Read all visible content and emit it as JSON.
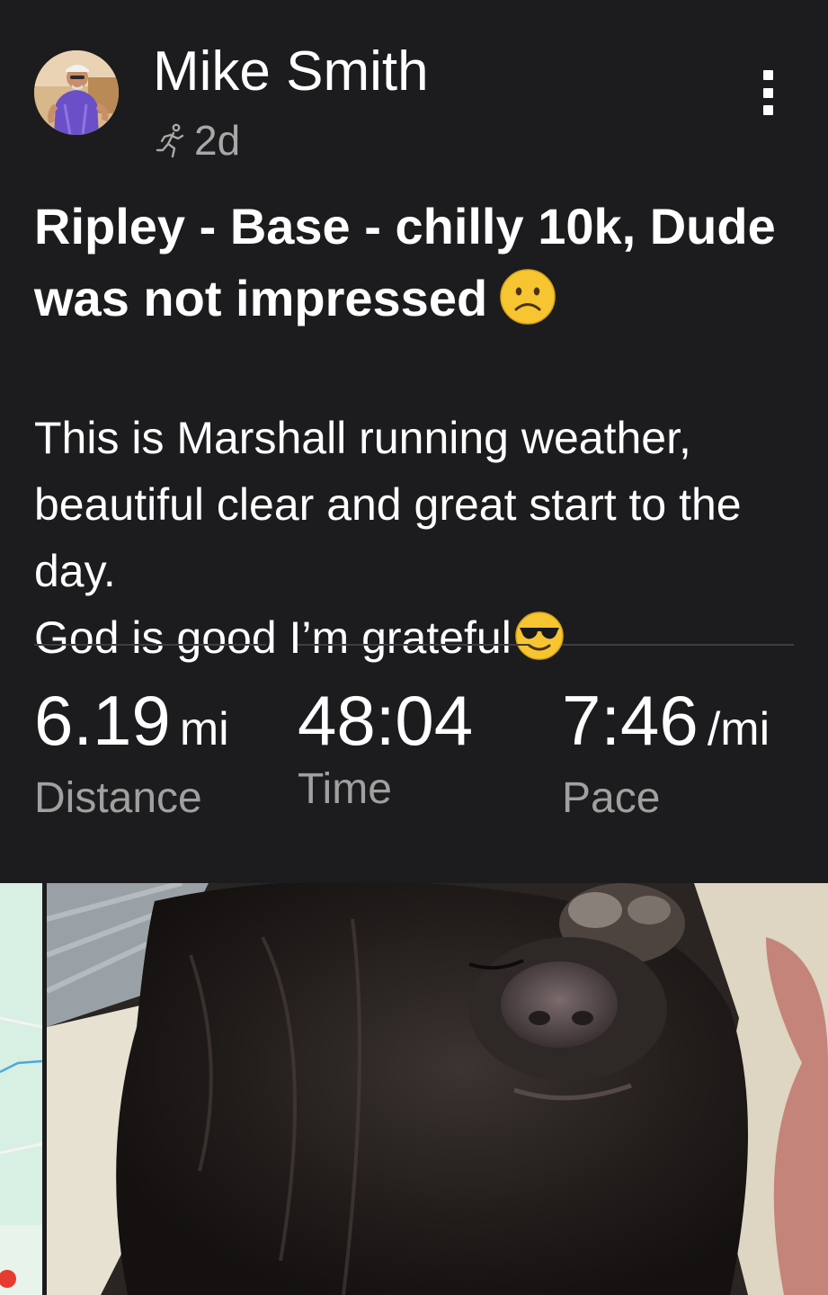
{
  "post": {
    "athlete_name": "Mike Smith",
    "activity_icon": "running-icon",
    "time_ago": "2d",
    "title": "Ripley - Base - chilly 10k, Dude was not impressed",
    "title_emoji": "frowning-face-emoji",
    "description": "This is Marshall running weather, beautiful clear and great start to the day.\nGod is good I’m grateful",
    "description_emoji": "smiling-face-with-sunglasses-emoji"
  },
  "stats": [
    {
      "value": "6.19",
      "unit": "mi",
      "label": "Distance"
    },
    {
      "value": "48:04",
      "unit": "",
      "label": "Time"
    },
    {
      "value": "7:46",
      "unit": "/mi",
      "label": "Pace"
    }
  ],
  "colors": {
    "background": "#1c1c1e",
    "primary_text": "#ffffff",
    "secondary_text": "#a0a0a0",
    "divider": "#3e3e42",
    "emoji_yellow": "#f7c531",
    "map_green": "#d8efe3",
    "map_route": "#4aa8e0"
  }
}
